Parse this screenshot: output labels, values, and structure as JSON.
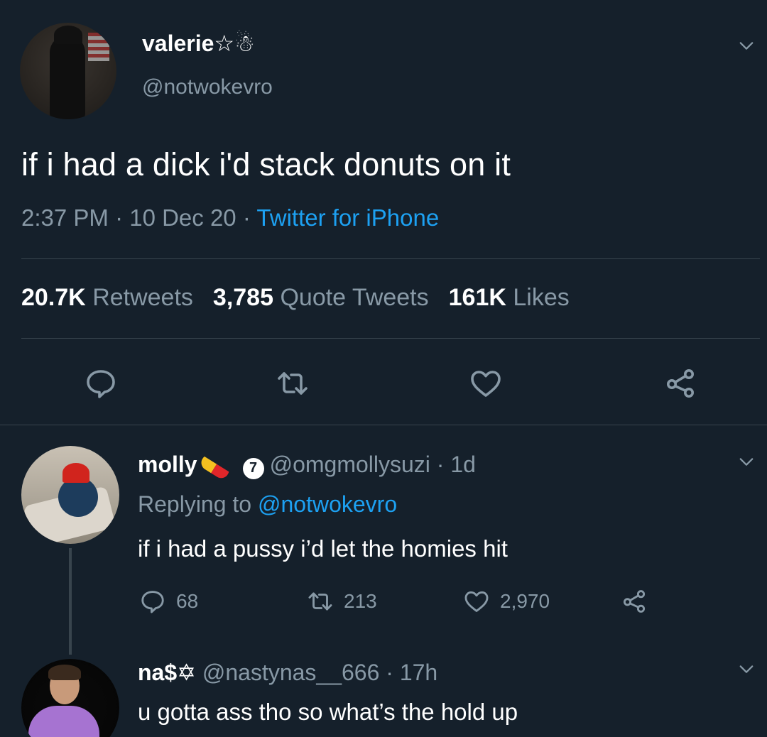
{
  "main_tweet": {
    "display_name": "valerie☆☃",
    "handle": "@notwokevro",
    "text": "if i had a dick i'd stack donuts on it",
    "time_date": "2:37 PM · 10 Dec 20 ·",
    "source": "Twitter for iPhone",
    "stats": [
      {
        "value": "20.7K",
        "label": "Retweets"
      },
      {
        "value": "3,785",
        "label": "Quote Tweets"
      },
      {
        "value": "161K",
        "label": "Likes"
      }
    ],
    "actions": [
      "reply-icon",
      "retweet-icon",
      "like-icon",
      "share-icon"
    ]
  },
  "replies": [
    {
      "display_name": "molly",
      "badge": "7",
      "handle_time": "@omgmollysuzi · 1d",
      "replying_prefix": "Replying to",
      "replying_to": "@notwokevro",
      "text": "if i had a pussy i’d let the homies hit",
      "reply_count": "68",
      "retweet_count": "213",
      "like_count": "2,970"
    },
    {
      "display_name": "na$✡",
      "handle_time": "@nastynas__666 · 17h",
      "text": "u gotta ass tho so what’s the hold up"
    }
  ],
  "colors": {
    "background": "#15202b",
    "muted_text": "#8899a6",
    "link": "#1da1f2",
    "divider": "#38444d"
  }
}
